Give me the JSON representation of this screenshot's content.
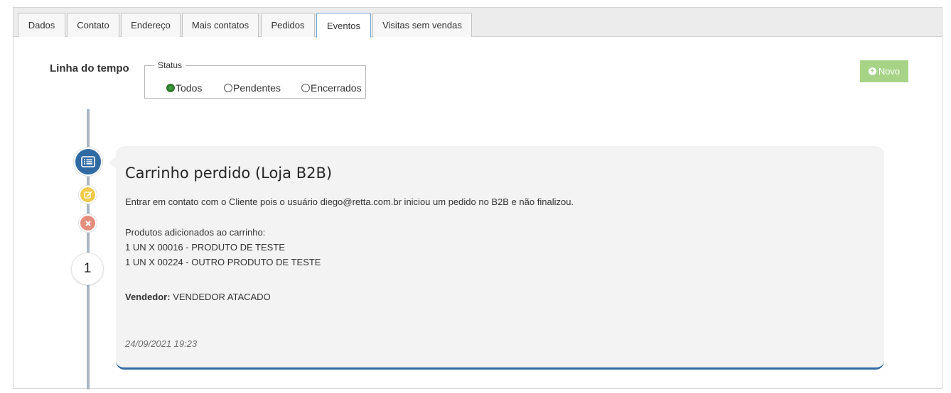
{
  "tabs": [
    {
      "label": "Dados"
    },
    {
      "label": "Contato"
    },
    {
      "label": "Endereço"
    },
    {
      "label": "Mais contatos"
    },
    {
      "label": "Pedidos"
    },
    {
      "label": "Eventos",
      "active": true
    },
    {
      "label": "Visitas sem vendas"
    }
  ],
  "timeline": {
    "title": "Linha do tempo",
    "status_legend": "Status",
    "filters": [
      {
        "label": "Todos",
        "checked": true
      },
      {
        "label": "Pendentes",
        "checked": false
      },
      {
        "label": "Encerrados",
        "checked": false
      }
    ],
    "new_button_label": "Novo"
  },
  "event": {
    "number": "1",
    "title": "Carrinho perdido (Loja B2B)",
    "description": "Entrar em contato com o Cliente pois o usuário diego@retta.com.br iniciou um pedido no B2B e não finalizou.",
    "products_heading": "Produtos adicionados ao carrinho:",
    "products": [
      "1 UN X 00016 - PRODUTO DE TESTE",
      "1 UN X 00224 - OUTRO PRODUTO DE TESTE"
    ],
    "seller_label": "Vendedor:",
    "seller_value": "VENDEDOR ATACADO",
    "datetime": "24/09/2021 19:23"
  },
  "colors": {
    "accent_blue": "#2f6aa3",
    "new_button_green": "#a6d386",
    "edit_yellow": "#f2ca4a",
    "close_red": "#e58d7d"
  },
  "icons": {
    "main": "list-icon",
    "edit": "edit-icon",
    "close": "close-icon",
    "new": "plus-circle-icon"
  }
}
